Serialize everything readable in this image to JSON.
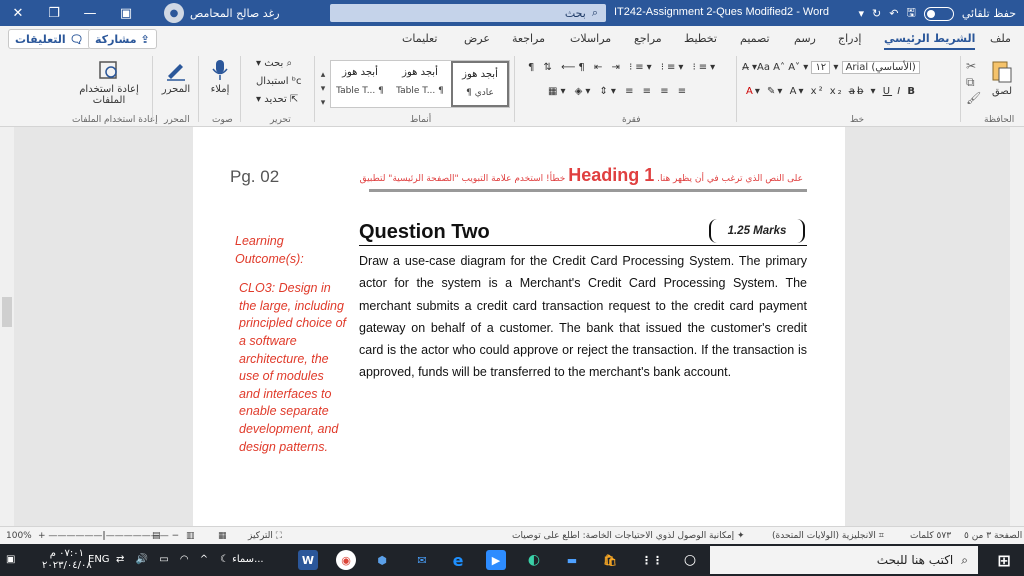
{
  "titlebar": {
    "user_name": "رغد صالح المحامص",
    "search_label": "بحث",
    "doc_title": "IT242-Assignment 2-Ques Modified2 - Word",
    "autosave_label": "حفظ تلقائي"
  },
  "tabs": {
    "items": [
      "ملف",
      "الشريط الرئيسي",
      "إدراج",
      "رسم",
      "تصميم",
      "تخطيط",
      "مراجع",
      "مراسلات",
      "مراجعة",
      "عرض",
      "تعليمات"
    ],
    "active": "الشريط الرئيسي",
    "share_label": "مشاركة",
    "comments_label": "التعليقات"
  },
  "ribbon": {
    "clipboard": {
      "paste": "لصق",
      "group": "الحافظة"
    },
    "font": {
      "name": "Arial (الأساسي)",
      "size": "١٢",
      "group": "خط"
    },
    "paragraph": {
      "group": "فقرة"
    },
    "styles": {
      "group": "أنماط",
      "tiles": [
        {
          "preview": "أبجد هوز",
          "name": "¶ عادي"
        },
        {
          "preview": "أبجد هوز",
          "name": "Table T... ¶"
        },
        {
          "preview": "أبجد هوز",
          "name": "Table T... ¶"
        }
      ]
    },
    "editing": {
      "find": "بحث",
      "replace": "استبدال",
      "select": "تحديد",
      "group": "تحرير"
    },
    "voice": {
      "dictate": "إملاء",
      "group": "صوت"
    },
    "editor": {
      "label": "المحرر",
      "group": "المحرر"
    },
    "reuse": {
      "label": "إعادة استخدام الملفات",
      "group": "إعادة استخدام الملفات"
    }
  },
  "document": {
    "page_label": "Pg. 02",
    "header_note_left": "على النص الذي ترغب في أن يظهر هنا.",
    "header_heading": "Heading 1",
    "header_note_right": "خطأ! استخدم علامة التبويب \"الصفحة الرئيسية\" لتطبيق",
    "learning_outcome_label": "Learning Outcome(s):",
    "clo_text": "CLO3: Design in the large, including principled choice of a software architecture, the use of modules and interfaces to enable separate development, and design patterns.",
    "question_title": "Question Two",
    "marks": "1.25 Marks",
    "question_body": "Draw a use-case diagram for the Credit Card Processing System. The primary actor for the system is a Merchant's Credit Card Processing System. The merchant submits a credit card transaction request to the credit card payment gateway on behalf of a customer. The bank that issued the customer's credit card is the actor who could approve or reject the transaction. If the transaction is approved, funds will be transferred to the merchant's bank account."
  },
  "statusbar": {
    "page_info": "الصفحة ٣ من ٥",
    "word_count": "٥٧٣ كلمات",
    "language": "الانجليزية (الولايات المتحدة)",
    "accessibility": "إمكانية الوصول لذوي الاحتياجات الخاصة: اطلع على توصيات",
    "focus": "التركيز",
    "zoom": "100%"
  },
  "taskbar": {
    "search_placeholder": "اكتب هنا للبحث",
    "weather": "سماء...",
    "lang": "ENG",
    "time": "٠٧:٠١ م",
    "date": "٢٠٢٣/٠٤/٠٨"
  }
}
